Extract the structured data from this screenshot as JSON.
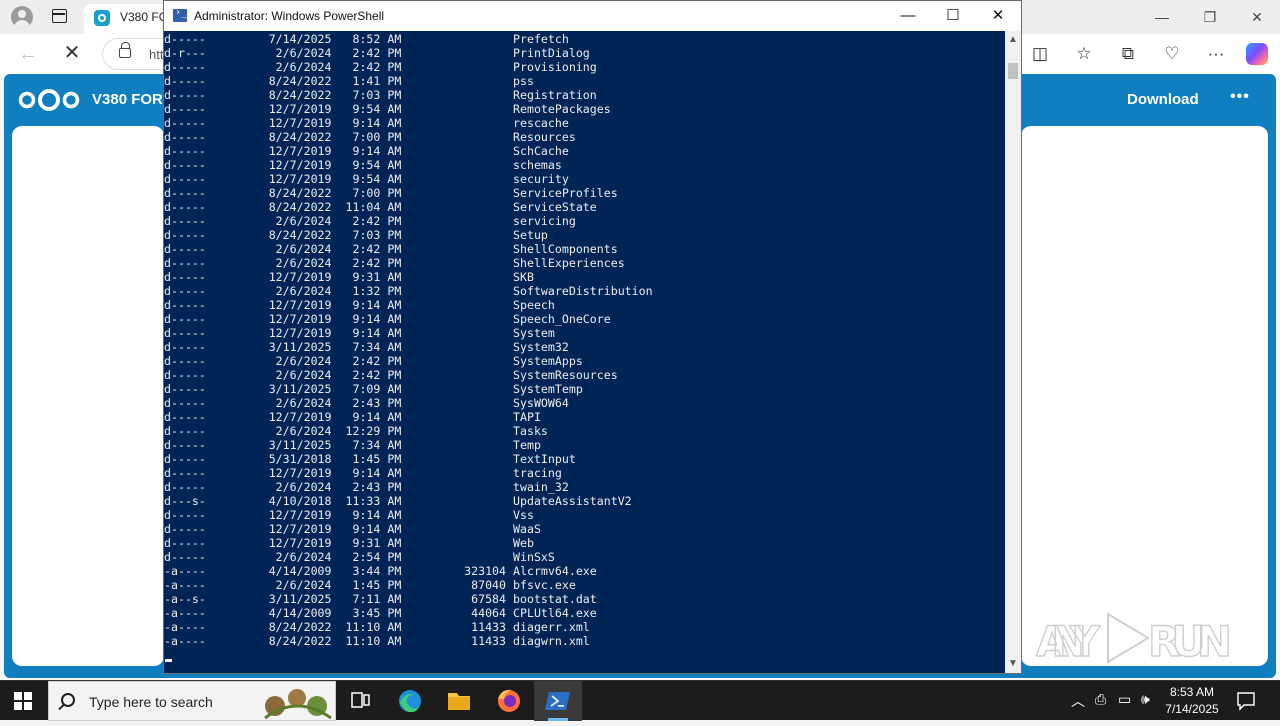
{
  "browser": {
    "tab_title": "V380 FO",
    "address_text": "htt",
    "window_controls": {
      "minimize": "—",
      "restore": "❐",
      "close": "✕"
    }
  },
  "nextcloud": {
    "title": "V380 FOR",
    "download_label": "Download",
    "more_label": "•••"
  },
  "watermark": {
    "text": "ANY RUN"
  },
  "powershell": {
    "title": "Administrator: Windows PowerShell",
    "controls": {
      "minimize": "—",
      "maximize": "☐",
      "close": "✕"
    },
    "lines": [
      "d-----         7/14/2025   8:52 AM                Prefetch",
      "d-r---          2/6/2024   2:42 PM                PrintDialog",
      "d-----          2/6/2024   2:42 PM                Provisioning",
      "d-----         8/24/2022   1:41 PM                pss",
      "d-----         8/24/2022   7:03 PM                Registration",
      "d-----         12/7/2019   9:54 AM                RemotePackages",
      "d-----         12/7/2019   9:14 AM                rescache",
      "d-----         8/24/2022   7:00 PM                Resources",
      "d-----         12/7/2019   9:14 AM                SchCache",
      "d-----         12/7/2019   9:54 AM                schemas",
      "d-----         12/7/2019   9:54 AM                security",
      "d-----         8/24/2022   7:00 PM                ServiceProfiles",
      "d-----         8/24/2022  11:04 AM                ServiceState",
      "d-----          2/6/2024   2:42 PM                servicing",
      "d-----         8/24/2022   7:03 PM                Setup",
      "d-----          2/6/2024   2:42 PM                ShellComponents",
      "d-----          2/6/2024   2:42 PM                ShellExperiences",
      "d-----         12/7/2019   9:31 AM                SKB",
      "d-----          2/6/2024   1:32 PM                SoftwareDistribution",
      "d-----         12/7/2019   9:14 AM                Speech",
      "d-----         12/7/2019   9:14 AM                Speech_OneCore",
      "d-----         12/7/2019   9:14 AM                System",
      "d-----         3/11/2025   7:34 AM                System32",
      "d-----          2/6/2024   2:42 PM                SystemApps",
      "d-----          2/6/2024   2:42 PM                SystemResources",
      "d-----         3/11/2025   7:09 AM                SystemTemp",
      "d-----          2/6/2024   2:43 PM                SysWOW64",
      "d-----         12/7/2019   9:14 AM                TAPI",
      "d-----          2/6/2024  12:29 PM                Tasks",
      "d-----         3/11/2025   7:34 AM                Temp",
      "d-----         5/31/2018   1:45 PM                TextInput",
      "d-----         12/7/2019   9:14 AM                tracing",
      "d-----          2/6/2024   2:43 PM                twain_32",
      "d---s-         4/10/2018  11:33 AM                UpdateAssistantV2",
      "d-----         12/7/2019   9:14 AM                Vss",
      "d-----         12/7/2019   9:14 AM                WaaS",
      "d-----         12/7/2019   9:31 AM                Web",
      "d-----          2/6/2024   2:54 PM                WinSxS",
      "-a----         4/14/2009   3:44 PM         323104 Alcrmv64.exe",
      "-a----          2/6/2024   1:45 PM          87040 bfsvc.exe",
      "-a--s-         3/11/2025   7:11 AM          67584 bootstat.dat",
      "-a----         4/14/2009   3:45 PM          44064 CPLUtl64.exe",
      "-a----         8/24/2022  11:10 AM          11433 diagerr.xml",
      "-a----         8/24/2022  11:10 AM          11433 diagwrn.xml"
    ]
  },
  "taskbar": {
    "search_placeholder": "Type here to search",
    "time": "8:53 AM",
    "date": "7/14/2025"
  },
  "colors": {
    "ps_background": "#012456",
    "ps_text": "#eeeeee",
    "nextcloud_blue": "#0f7fc0",
    "taskbar": "#1c1c1c"
  }
}
